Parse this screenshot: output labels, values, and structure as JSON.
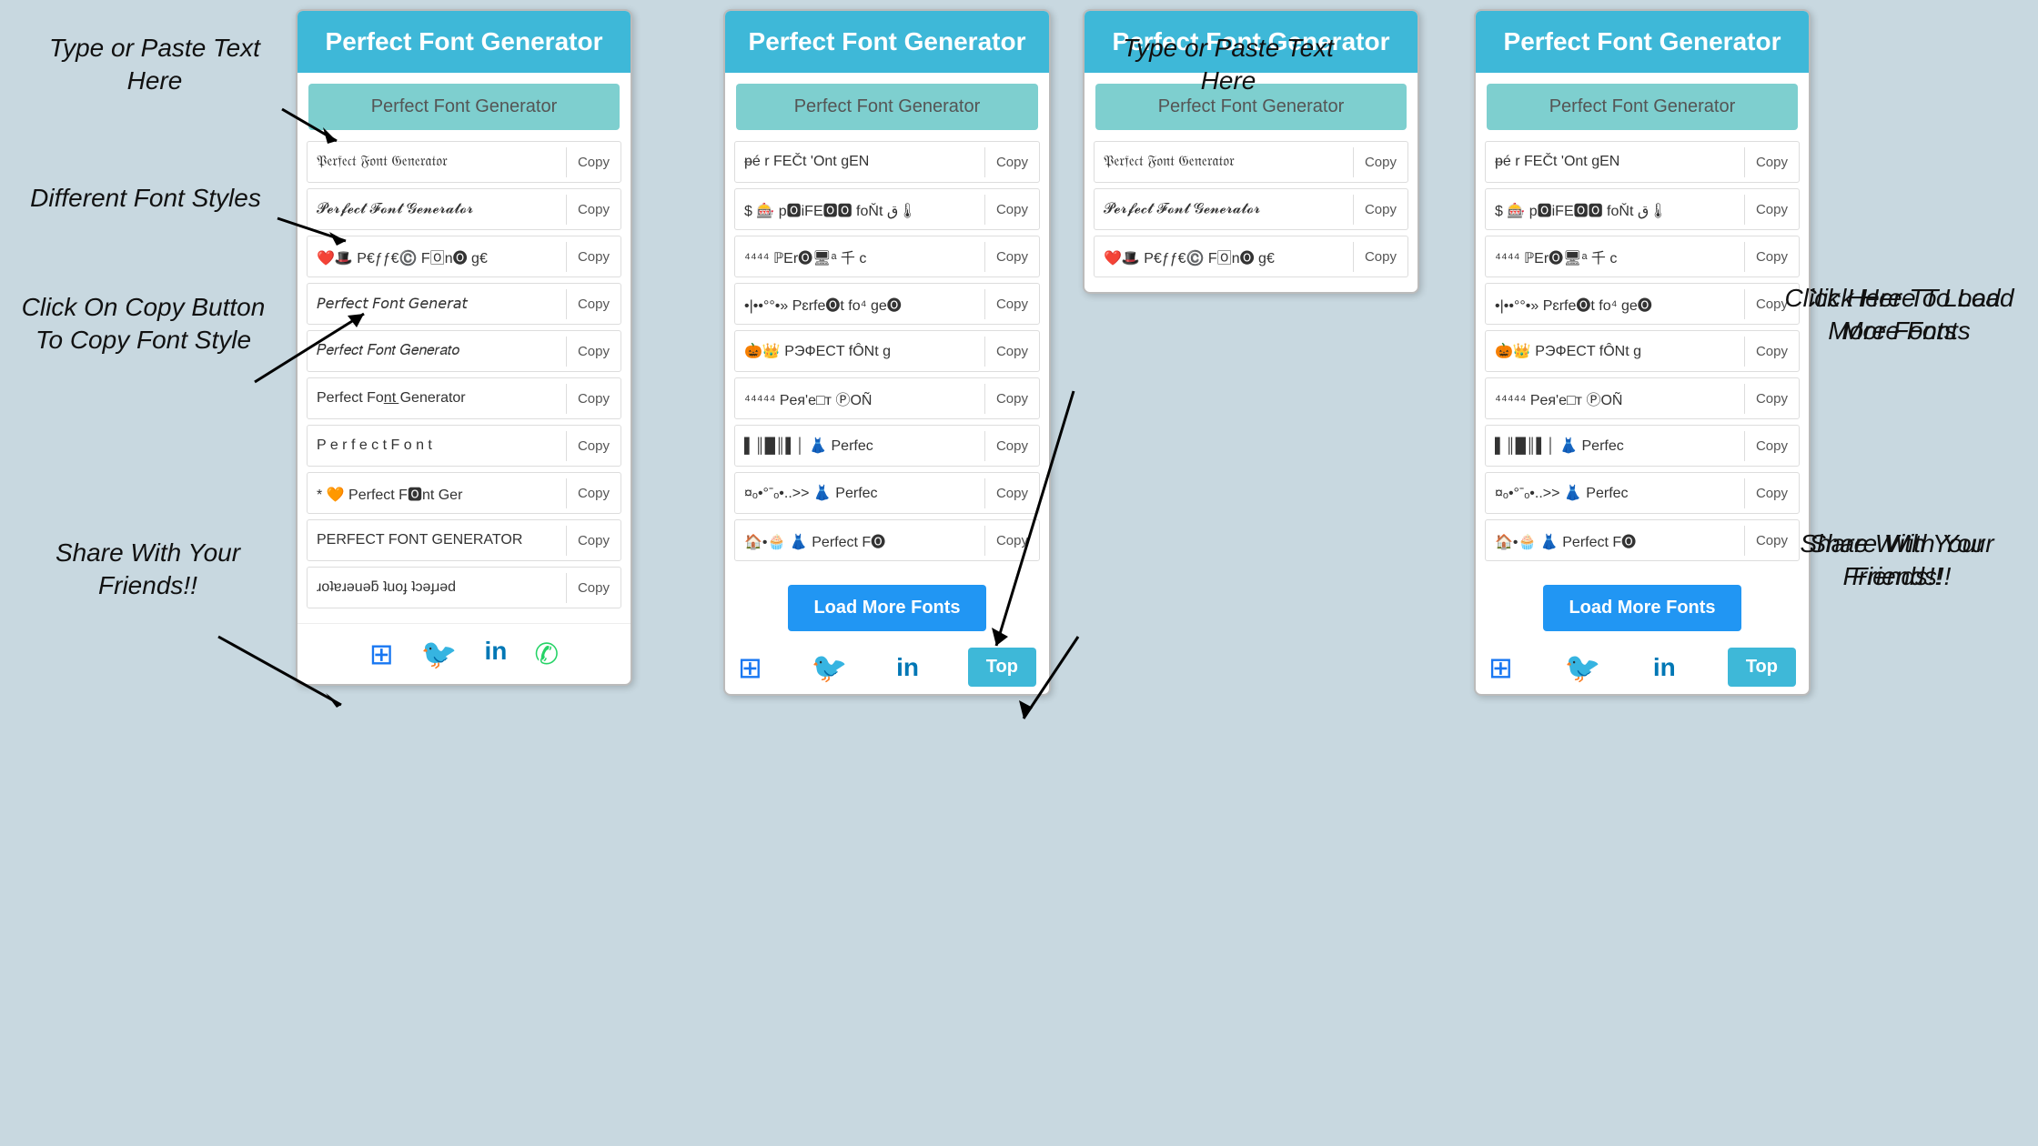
{
  "page": {
    "background": "#c8d8e0",
    "title": "Perfect Font Generator"
  },
  "annotations": {
    "type_paste": "Type or Paste Text Here",
    "diff_fonts": "Different Font Styles",
    "click_copy": "Click On Copy Button To Copy Font Style",
    "share": "Share With Your Friends!!",
    "load_more_hint": "Click Here To Load More Fonts",
    "share2": "Share With Your Friends!!"
  },
  "left_phone": {
    "header": "Perfect Font Generator",
    "input_value": "Perfect Font Generator",
    "fonts": [
      {
        "text": "𝔓𝔢𝔯𝔣𝔢𝔠𝔱 𝔉𝔬𝔫𝔱 𝔊𝔢𝔫𝔢𝔯𝔞𝔱𝔬𝔯",
        "copy": "Copy"
      },
      {
        "text": "𝓟𝓮𝓻𝓯𝓮𝓬𝓽 𝓕𝓸𝓷𝓽 𝓖𝓮𝓷𝓮𝓻𝓪𝓽𝓸𝓻",
        "copy": "Copy"
      },
      {
        "text": "❤️🎩 P€ƒƒ€©️ F🄾n🅞 g€",
        "copy": "Copy"
      },
      {
        "text": "𝘗𝘦𝘳𝘧𝘦𝘤𝘵 𝘍𝘰𝘯𝘵 𝘎𝘦𝘯𝘦𝘳𝘢𝘵",
        "copy": "Copy"
      },
      {
        "text": "𝑃𝑒𝑟𝑓𝑒𝑐𝑡 𝐹𝑜𝑛𝑡 𝐺𝑒𝑛𝑒𝑟𝑎𝑡𝑜",
        "copy": "Copy"
      },
      {
        "text": "Perfect Fon̲t̲ Generator",
        "copy": "Copy"
      },
      {
        "text": "P e r f e c t  F o n t",
        "copy": "Copy"
      },
      {
        "text": "* 🧡 Perfect F🅾nt Ger",
        "copy": "Copy"
      },
      {
        "text": "PERFECT FONT GENERATOR",
        "copy": "Copy"
      },
      {
        "text": "ɹoʇɐɹǝuǝƃ ʇuoɟ ʇɔǝɟɹǝd",
        "copy": "Copy"
      }
    ],
    "social": {
      "facebook": "f",
      "twitter": "🐦",
      "linkedin": "in",
      "whatsapp": "📱"
    }
  },
  "right_phone": {
    "header": "Perfect Font Generator",
    "input_value": "Perfect Font Generator",
    "fonts": [
      {
        "text": "ᵽé r FEČt 'Ont gEN",
        "copy": "Copy"
      },
      {
        "text": "$ 🎰 p🅾iFE🅾🅾 foŇt ق🌡",
        "copy": "Copy"
      },
      {
        "text": "⁴⁴⁴⁴ ℙEr🅞🖥ᵃ 千 c",
        "copy": "Copy"
      },
      {
        "text": "•|••°°•» Pɛrfe🅞t fo⁴ ge🅞",
        "copy": "Copy"
      },
      {
        "text": "🎃👑 PЭФЕСT fÔNt g",
        "copy": "Copy"
      },
      {
        "text": "⁴⁴⁴⁴⁴ Peя'e□т ⓅOÑ",
        "copy": "Copy"
      },
      {
        "text": "▌║█║▌│ 👗 Perfec",
        "copy": "Copy"
      },
      {
        "text": "¤ₒ•°ˉₒ•..>> 👗 Perfec",
        "copy": "Copy"
      },
      {
        "text": "🏠•🧁 👗 Perfect F🅞",
        "copy": "Copy"
      }
    ],
    "load_more": "Load More Fonts",
    "top_btn": "Top",
    "social": {
      "facebook": "f",
      "twitter": "🐦",
      "linkedin": "in"
    }
  }
}
